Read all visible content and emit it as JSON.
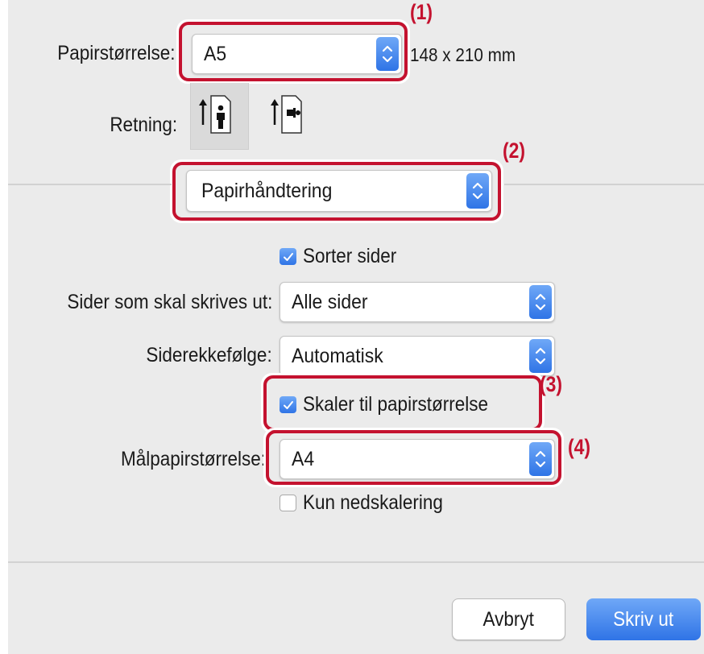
{
  "paper_size": {
    "label": "Papirstørrelse:",
    "value": "A5",
    "dimensions": "148 x 210 mm",
    "callout": "(1)"
  },
  "orientation": {
    "label": "Retning:",
    "options": [
      "portrait-icon",
      "landscape-icon"
    ],
    "selected": "portrait"
  },
  "section_menu": {
    "value": "Papirhåndtering",
    "callout": "(2)"
  },
  "collate": {
    "label": "Sorter sider",
    "checked": true
  },
  "pages_to_print": {
    "label": "Sider som skal skrives ut:",
    "value": "Alle sider"
  },
  "page_order": {
    "label": "Siderekkefølge:",
    "value": "Automatisk"
  },
  "scale_to_paper": {
    "label": "Skaler til papirstørrelse",
    "checked": true,
    "callout": "(3)"
  },
  "target_paper": {
    "label": "Målpapirstørrelse:",
    "value": "A4",
    "callout": "(4)"
  },
  "scale_down_only": {
    "label": "Kun nedskalering",
    "checked": false
  },
  "buttons": {
    "cancel": "Avbryt",
    "print": "Skriv ut"
  },
  "colors": {
    "accent": "#2f74e6",
    "callout": "#c4122f",
    "background": "#ebebeb"
  }
}
